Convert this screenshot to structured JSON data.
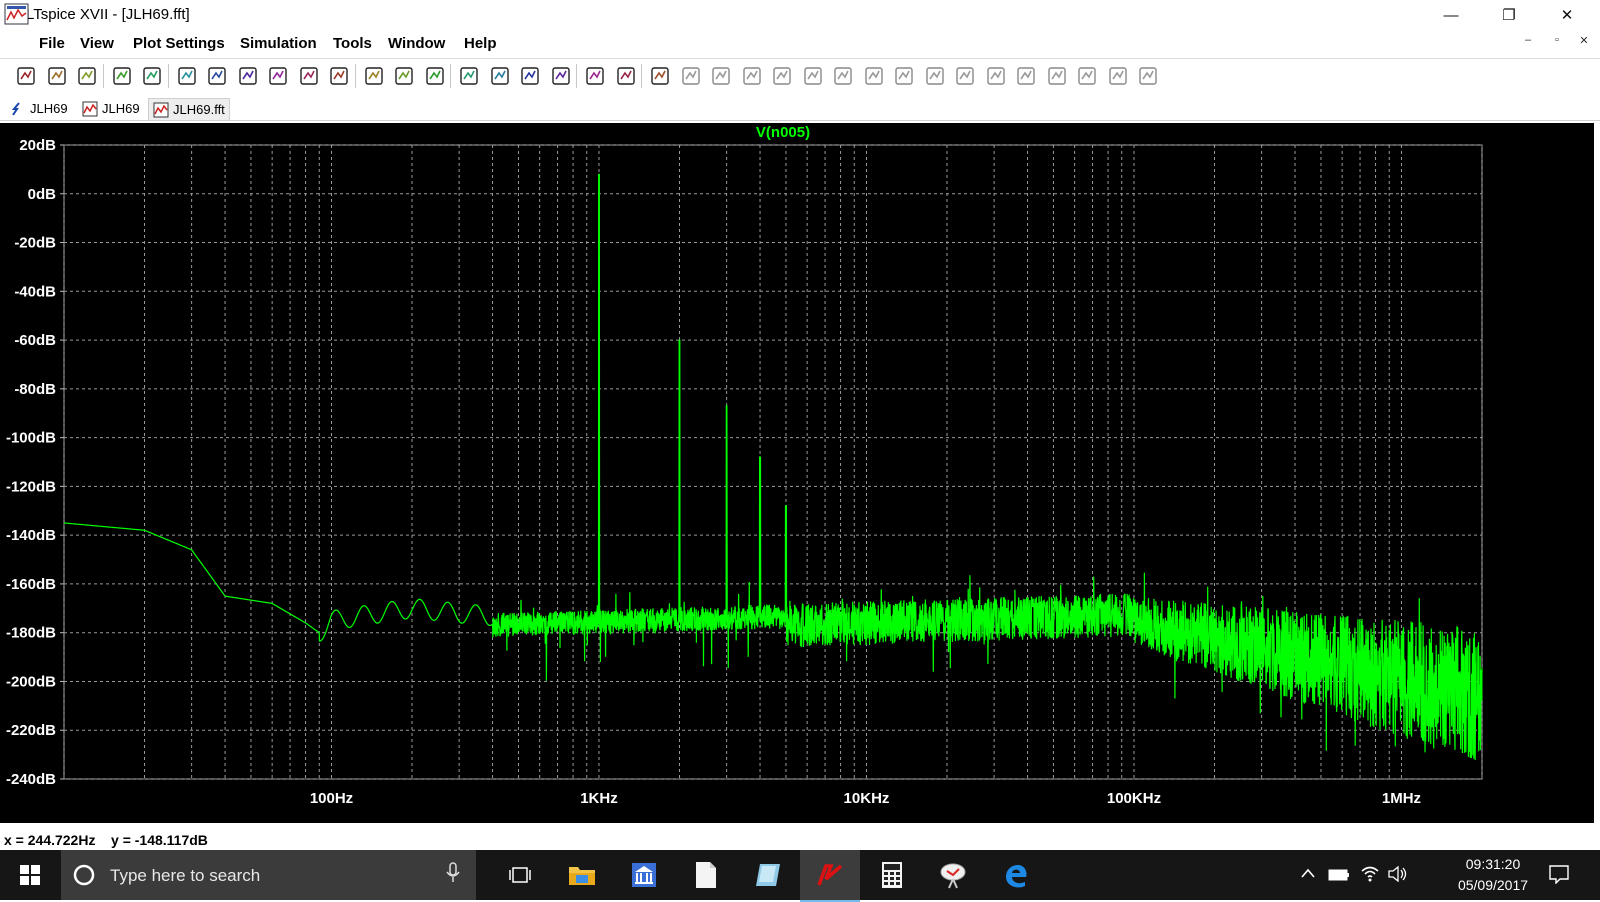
{
  "window": {
    "title": "LTspice XVII - [JLH69.fft]",
    "minimize_glyph": "—",
    "restore_glyph": "❐",
    "close_glyph": "✕"
  },
  "menu": {
    "items": [
      "File",
      "View",
      "Plot Settings",
      "Simulation",
      "Tools",
      "Window",
      "Help"
    ],
    "mdi": [
      "–",
      "▫",
      "✕"
    ]
  },
  "toolbar": {
    "icons": [
      "new-schematic-icon",
      "open-icon",
      "save-icon",
      "control-panel-icon",
      "run-icon",
      "halt-icon",
      "zoom-in-icon",
      "zoom-area-icon",
      "zoom-out-icon",
      "zoom-full-icon",
      "autorange-icon",
      "plot-setup-icon",
      "tile-horizontal-icon",
      "tile-vertical-icon",
      "cascade-icon",
      "cut-icon",
      "copy-icon",
      "paste-icon",
      "find-icon",
      "print-icon",
      "print-setup-icon",
      "draw-wire-icon",
      "ground-icon",
      "label-net-icon",
      "resistor-icon",
      "capacitor-icon",
      "inductor-icon",
      "diode-icon",
      "component-icon",
      "move-icon",
      "drag-icon",
      "undo-icon",
      "redo-icon",
      "rotate-icon",
      "mirror-icon",
      "text-icon",
      "spice-directive-icon"
    ]
  },
  "tabs": [
    {
      "label": "JLH69",
      "icon": "schematic-icon"
    },
    {
      "label": "JLH69",
      "icon": "waveform-icon"
    },
    {
      "label": "JLH69.fft",
      "icon": "fft-icon",
      "active": true
    }
  ],
  "plot": {
    "trace_label": "V(n005)",
    "trace_color": "#00ff00",
    "grid_color": "#9a9a9a",
    "y_ticks": [
      "20dB",
      "0dB",
      "-20dB",
      "-40dB",
      "-60dB",
      "-80dB",
      "-100dB",
      "-120dB",
      "-140dB",
      "-160dB",
      "-180dB",
      "-200dB",
      "-220dB",
      "-240dB"
    ],
    "x_ticks": [
      "100Hz",
      "1KHz",
      "10KHz",
      "100KHz",
      "1MHz"
    ]
  },
  "chart_data": {
    "type": "line",
    "title": "V(n005)",
    "x_scale": "log",
    "xlim": [
      10,
      2000000
    ],
    "ylim": [
      -240,
      20
    ],
    "grid": true,
    "series": [
      {
        "name": "V(n005)",
        "x": [
          10,
          20,
          30,
          40,
          60,
          80,
          90,
          100,
          150,
          200,
          300,
          500,
          900,
          1000,
          1100,
          1900,
          2000,
          2100,
          2900,
          3000,
          3100,
          3900,
          4000,
          4100,
          4900,
          5000,
          5100,
          10000,
          30000,
          100000,
          300000,
          1000000,
          2000000
        ],
        "y": [
          -135,
          -138,
          -146,
          -165,
          -168,
          -176,
          -180,
          -175,
          -172,
          -170,
          -172,
          -174,
          -172,
          8,
          -172,
          -172,
          -60,
          -174,
          -174,
          -87,
          -174,
          -174,
          -108,
          -174,
          -174,
          -128,
          -172,
          -170,
          -168,
          -166,
          -165,
          -170,
          -178
        ]
      }
    ]
  },
  "status": {
    "text": "x = 244.722Hz    y = -148.117dB"
  },
  "taskbar": {
    "search_placeholder": "Type here to search",
    "clock_time": "09:31:20",
    "clock_date": "05/09/2017"
  }
}
